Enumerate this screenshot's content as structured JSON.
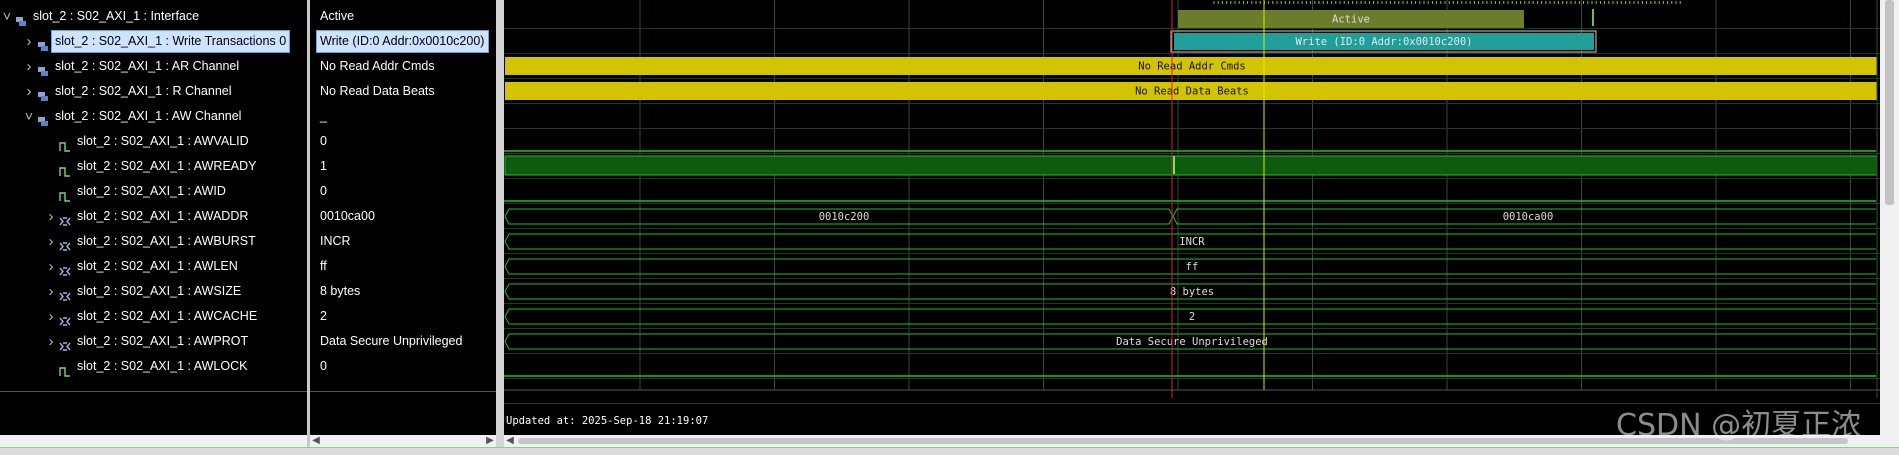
{
  "names_panel": {
    "rows": [
      {
        "label": "slot_2 : S02_AXI_1 : Interface",
        "expander": "chevron-down",
        "icon": "interface-icon"
      },
      {
        "label": "slot_2 : S02_AXI_1 : Write Transactions 0",
        "expander": "chevron-right",
        "icon": "transaction-icon",
        "selected": true
      },
      {
        "label": "slot_2 : S02_AXI_1 : AR Channel",
        "expander": "chevron-right",
        "icon": "channel-icon"
      },
      {
        "label": "slot_2 : S02_AXI_1 : R Channel",
        "expander": "chevron-right",
        "icon": "channel-icon"
      },
      {
        "label": "slot_2 : S02_AXI_1 : AW Channel",
        "expander": "chevron-down",
        "icon": "channel-icon"
      },
      {
        "label": "slot_2 : S02_AXI_1 : AWVALID",
        "expander": "",
        "icon": "signal-icon"
      },
      {
        "label": "slot_2 : S02_AXI_1 : AWREADY",
        "expander": "",
        "icon": "signal-icon"
      },
      {
        "label": "slot_2 : S02_AXI_1 : AWID",
        "expander": "",
        "icon": "signal-icon"
      },
      {
        "label": "slot_2 : S02_AXI_1 : AWADDR",
        "expander": "chevron-right",
        "icon": "bus-icon"
      },
      {
        "label": "slot_2 : S02_AXI_1 : AWBURST",
        "expander": "chevron-right",
        "icon": "bus-icon"
      },
      {
        "label": "slot_2 : S02_AXI_1 : AWLEN",
        "expander": "chevron-right",
        "icon": "bus-icon"
      },
      {
        "label": "slot_2 : S02_AXI_1 : AWSIZE",
        "expander": "chevron-right",
        "icon": "bus-icon"
      },
      {
        "label": "slot_2 : S02_AXI_1 : AWCACHE",
        "expander": "chevron-right",
        "icon": "bus-icon"
      },
      {
        "label": "slot_2 : S02_AXI_1 : AWPROT",
        "expander": "chevron-right",
        "icon": "bus-icon"
      },
      {
        "label": "slot_2 : S02_AXI_1 : AWLOCK",
        "expander": "",
        "icon": "signal-icon"
      }
    ]
  },
  "values_panel": {
    "rows": [
      {
        "value": "Active"
      },
      {
        "value": "Write (ID:0 Addr:0x0010c200)",
        "selected": true
      },
      {
        "value": "No Read Addr Cmds"
      },
      {
        "value": "No Read Data Beats"
      },
      {
        "value": "_"
      },
      {
        "value": "0"
      },
      {
        "value": "1"
      },
      {
        "value": "0"
      },
      {
        "value": "0010ca00"
      },
      {
        "value": "INCR"
      },
      {
        "value": "ff"
      },
      {
        "value": "8 bytes"
      },
      {
        "value": "2"
      },
      {
        "value": "Data Secure Unprivileged"
      },
      {
        "value": "0"
      }
    ]
  },
  "waveform": {
    "interface_label": "Active",
    "transaction_label": "Write (ID:0 Addr:0x0010c200)",
    "ar_channel_label": "No Read Addr Cmds",
    "r_channel_label": "No Read Data Beats",
    "awaddr_before": "0010c200",
    "awaddr_after": "0010ca00",
    "awburst": "INCR",
    "awlen": "ff",
    "awsize": "8 bytes",
    "awcache": "2",
    "awprot": "Data Secure Unprivileged",
    "updated_text": "Updated at: 2025-Sep-18 21:19:07",
    "colors": {
      "grid": "#2f4f2f",
      "signal": "#22c022",
      "interface_bar": "#6b7d2a",
      "transaction_bar": "#1f9e9a",
      "read_bar": "#d4c400",
      "cursor_red": "#e0201c",
      "marker_yellow": "#e6e600",
      "selection": "#cde3ff"
    }
  },
  "watermark": "CSDN @初夏正浓"
}
